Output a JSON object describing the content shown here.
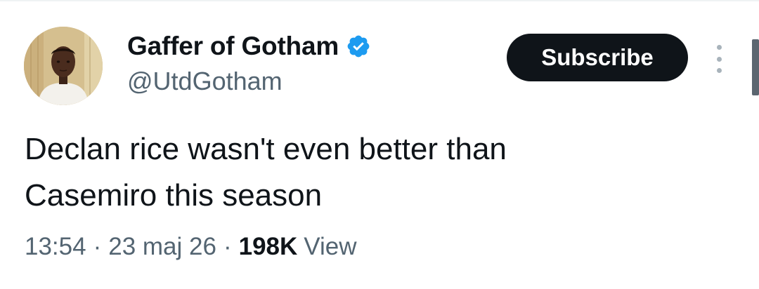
{
  "author": {
    "display_name": "Gaffer of Gotham",
    "handle": "@UtdGotham",
    "verified": true,
    "avatar_icon": "user-avatar"
  },
  "actions": {
    "subscribe_label": "Subscribe",
    "more_icon": "more-options-icon"
  },
  "tweet": {
    "text": "Declan rice wasn't even better than\nCasemiro this season"
  },
  "meta": {
    "time": "13:54",
    "separator": "·",
    "date": "23 maj 26",
    "views_count": "198K",
    "views_label": "View"
  },
  "colors": {
    "text_primary": "#0f1419",
    "text_secondary": "#536471",
    "verified_blue": "#1d9bf0",
    "button_bg": "#0f1419"
  }
}
